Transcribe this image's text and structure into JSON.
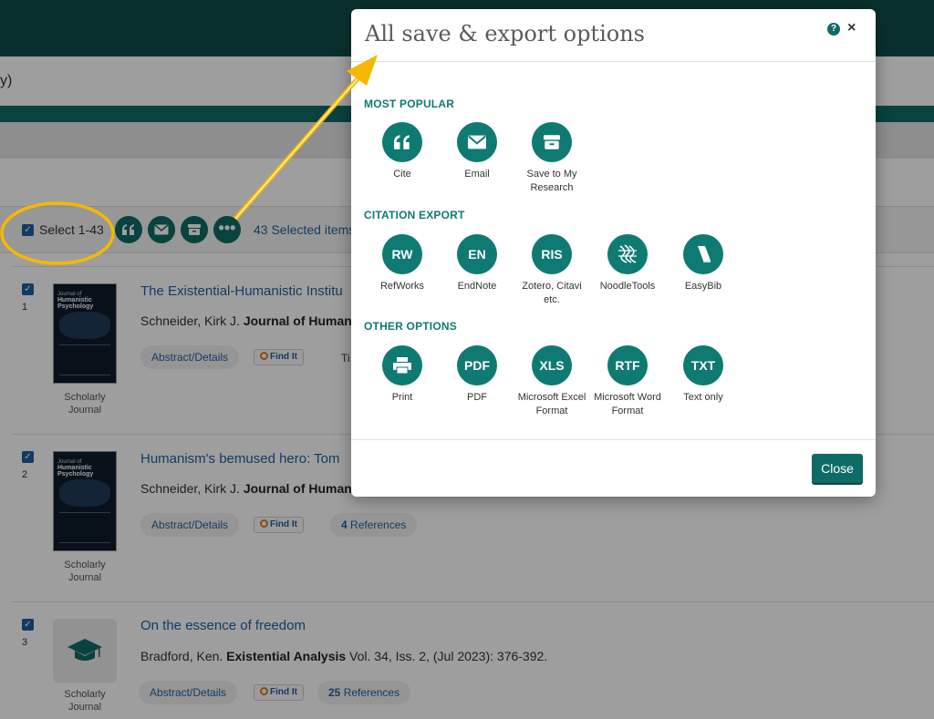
{
  "background": {
    "search_query_fragment": "y)",
    "toolbar": {
      "select_label": "Select 1-43",
      "selected_count": "43 Selected items",
      "icons": [
        "quote-icon",
        "email-icon",
        "save-folder-icon",
        "more-options-icon"
      ]
    },
    "results": [
      {
        "number": "1",
        "title": "The Existential-Humanistic Institu",
        "author": "Schneider, Kirk J.",
        "journal": "Journal of Humanis",
        "doc_type": "Scholarly Journal",
        "thumb_top": "Journal of",
        "thumb_title": "Humanistic Psychology",
        "actions": [
          "Abstract/Details",
          "Find It"
        ],
        "extra_fragment": "Ti"
      },
      {
        "number": "2",
        "title": "Humanism's bemused hero: Tom",
        "author": "Schneider, Kirk J.",
        "journal": "Journal of Humanis",
        "doc_type": "Scholarly Journal",
        "thumb_top": "Journal of",
        "thumb_title": "Humanistic Psychology",
        "actions": [
          "Abstract/Details",
          "Find It"
        ],
        "references_count": "4",
        "references_label": "References"
      },
      {
        "number": "3",
        "title": "On the essence of freedom",
        "author": "Bradford, Ken.",
        "journal": "Existential Analysis",
        "citation": "Vol. 34, Iss. 2,  (Jul 2023): 376-392.",
        "doc_type": "Scholarly Journal",
        "actions": [
          "Abstract/Details",
          "Find It"
        ],
        "references_count": "25",
        "references_label": "References"
      }
    ]
  },
  "modal": {
    "title": "All save & export options",
    "help_label": "?",
    "close_x": "×",
    "sections": [
      {
        "heading": "MOST POPULAR",
        "options": [
          {
            "label": "Cite",
            "icon": "quote-icon"
          },
          {
            "label": "Email",
            "icon": "email-icon"
          },
          {
            "label": "Save to My Research",
            "icon": "save-folder-icon"
          }
        ]
      },
      {
        "heading": "CITATION EXPORT",
        "options": [
          {
            "label": "RefWorks",
            "abbr": "RW"
          },
          {
            "label": "EndNote",
            "abbr": "EN"
          },
          {
            "label": "Zotero, Citavi etc.",
            "abbr": "RIS"
          },
          {
            "label": "NoodleTools",
            "icon": "noodletools-icon"
          },
          {
            "label": "EasyBib",
            "icon": "easybib-icon"
          }
        ]
      },
      {
        "heading": "OTHER OPTIONS",
        "options": [
          {
            "label": "Print",
            "icon": "print-icon"
          },
          {
            "label": "PDF",
            "abbr": "PDF"
          },
          {
            "label": "Microsoft Excel Format",
            "abbr": "XLS"
          },
          {
            "label": "Microsoft Word Format",
            "abbr": "RTF"
          },
          {
            "label": "Text only",
            "abbr": "TXT"
          }
        ]
      }
    ],
    "close_button": "Close"
  },
  "colors": {
    "teal": "#0f7a72",
    "dark_teal": "#0f4e4b",
    "link_blue": "#1f5f9e",
    "annotation_yellow": "#f5b800"
  }
}
